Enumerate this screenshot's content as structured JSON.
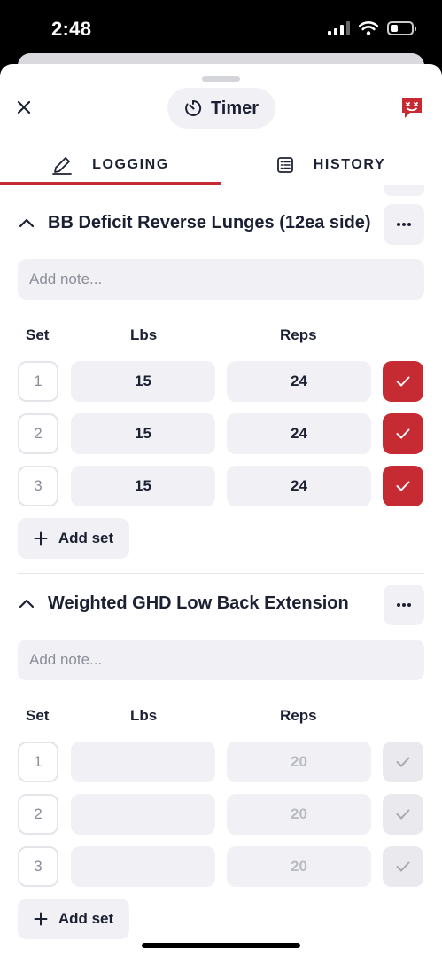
{
  "status_bar": {
    "time": "2:48"
  },
  "header": {
    "timer_label": "Timer"
  },
  "tabs": [
    {
      "label": "LOGGING",
      "active": true
    },
    {
      "label": "HISTORY",
      "active": false
    }
  ],
  "colors": {
    "accent": "#c62a32",
    "text": "#1c2033",
    "muted": "#8b8e98",
    "field": "#f1f1f5"
  },
  "columns": {
    "set": "Set",
    "lbs": "Lbs",
    "reps": "Reps"
  },
  "exercises": [
    {
      "title": "BB Deficit Reverse Lunges (12ea side)",
      "note_placeholder": "Add note...",
      "sets": [
        {
          "num": "1",
          "lbs": "15",
          "reps": "24",
          "done": true
        },
        {
          "num": "2",
          "lbs": "15",
          "reps": "24",
          "done": true
        },
        {
          "num": "3",
          "lbs": "15",
          "reps": "24",
          "done": true
        }
      ],
      "add_set_label": "Add set"
    },
    {
      "title": "Weighted GHD Low Back Extension",
      "note_placeholder": "Add note...",
      "sets": [
        {
          "num": "1",
          "lbs": "",
          "reps": "20",
          "done": false
        },
        {
          "num": "2",
          "lbs": "",
          "reps": "20",
          "done": false
        },
        {
          "num": "3",
          "lbs": "",
          "reps": "20",
          "done": false
        }
      ],
      "add_set_label": "Add set"
    }
  ]
}
